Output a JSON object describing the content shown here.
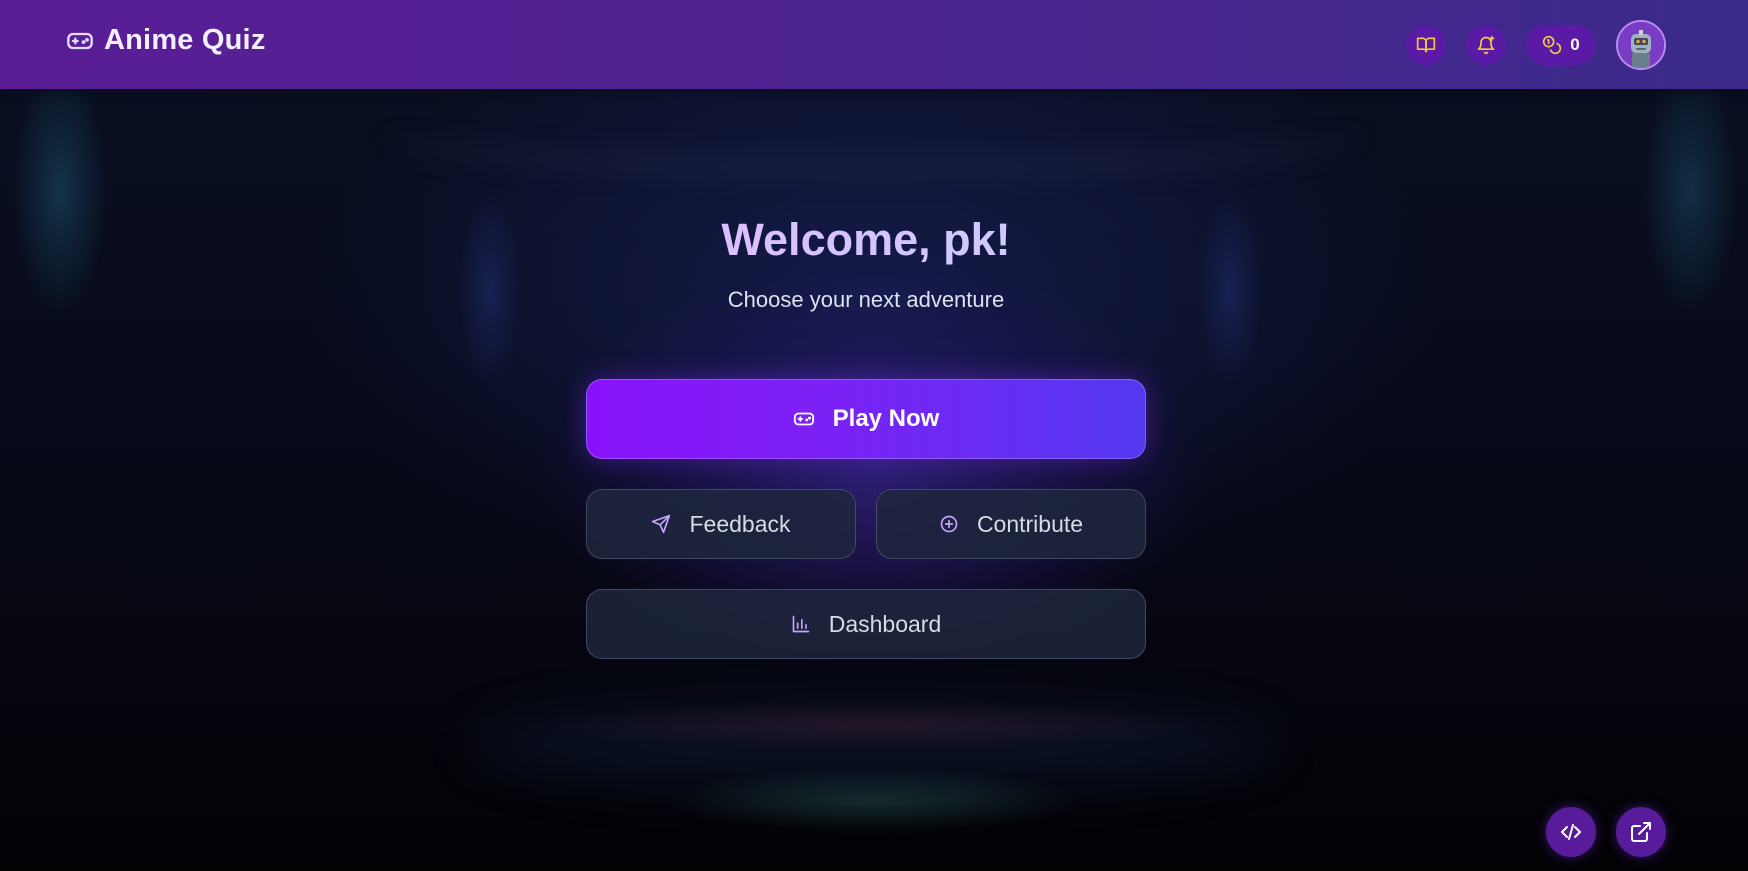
{
  "header": {
    "title": "Anime Quiz",
    "brand_icon": "gamepad-icon",
    "actions": [
      {
        "name": "book-icon",
        "color": "#f5c842"
      },
      {
        "name": "bell-plus-icon",
        "color": "#f5c842"
      }
    ],
    "coins": {
      "icon": "coins-icon",
      "count": "0",
      "color": "#f5c842"
    }
  },
  "main": {
    "welcome": "Welcome, pk!",
    "subtitle": "Choose your next adventure",
    "buttons": {
      "play": "Play Now",
      "feedback": "Feedback",
      "contribute": "Contribute",
      "dashboard": "Dashboard"
    }
  },
  "floating": [
    {
      "name": "code-icon"
    },
    {
      "name": "external-link-icon"
    }
  ],
  "colors": {
    "header_start": "#5a1d96",
    "header_end": "#3b2a8a",
    "play_start": "#8a12fb",
    "play_end": "#5338f0",
    "icon_accent": "#c8a2ff",
    "coin_accent": "#f5c842"
  }
}
